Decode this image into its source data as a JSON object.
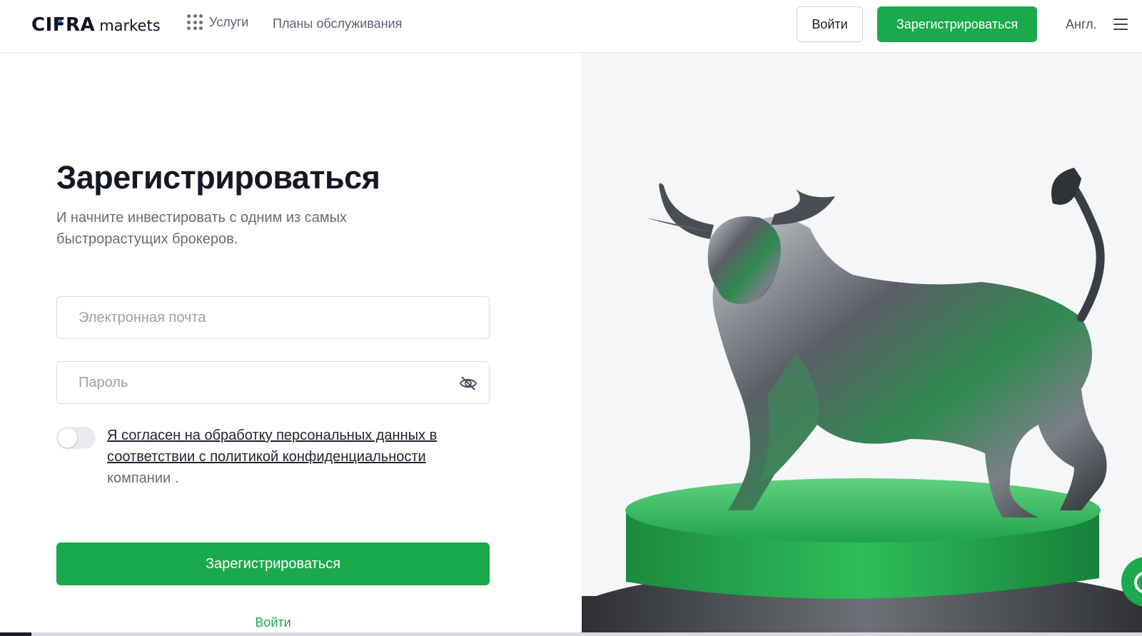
{
  "header": {
    "logo_brand": "CIFRA",
    "logo_sub": "markets",
    "services_label": "Услуги",
    "plans_label": "Планы обслуживания",
    "login_label": "Войти",
    "register_label": "Зарегистрироваться",
    "language_label": "Англ."
  },
  "form": {
    "title": "Зарегистрироваться",
    "subtitle": "И начните инвестировать с одним из самых быстрорастущих брокеров.",
    "email_placeholder": "Электронная почта",
    "email_value": "",
    "password_placeholder": "Пароль",
    "password_value": "",
    "consent_toggle_on": false,
    "consent_link_text": "Я согласен на обработку персональных данных в соответствии с политикой конфиденциальности",
    "consent_rest_text": " компании .",
    "register_button": "Зарегистрироваться",
    "login_link": "Войти"
  },
  "hero": {
    "image_subject": "chrome-bull-statue-on-green-pedestal"
  },
  "icons": {
    "services": "grid-dots-icon",
    "menu": "hamburger-menu-icon",
    "password_toggle": "eye-slash-icon",
    "chat": "chat-bubble-icon"
  },
  "colors": {
    "brand_green": "#1aa94b",
    "logo_accent": "#3d8bff",
    "text_dark": "#141826",
    "text_muted": "#656b78",
    "hero_bg": "#f5f6f8"
  }
}
